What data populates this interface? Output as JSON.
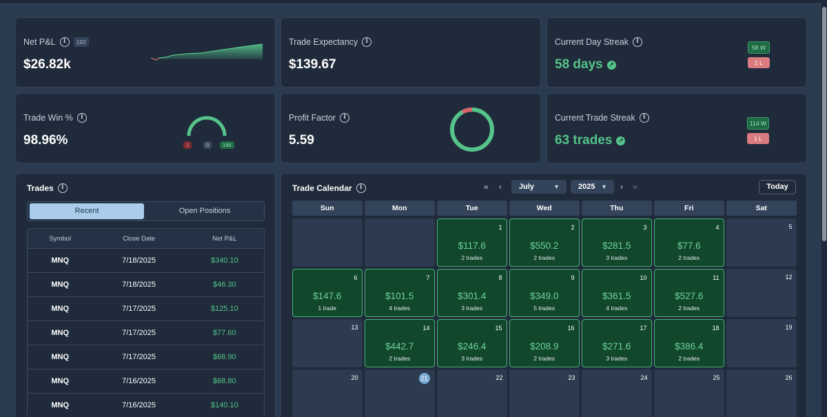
{
  "stats": {
    "net_pnl": {
      "title": "Net P&L",
      "badge": "192",
      "value": "$26.82k"
    },
    "trade_expectancy": {
      "title": "Trade Expectancy",
      "value": "$139.67"
    },
    "day_streak": {
      "title": "Current Day Streak",
      "value": "58 days",
      "wins": "58 W",
      "losses": "1 L"
    },
    "win_pct": {
      "title": "Trade Win %",
      "value": "98.96%",
      "losses": "2",
      "breakeven": "0",
      "wins": "190",
      "win_fraction": 0.9896
    },
    "profit_factor": {
      "title": "Profit Factor",
      "value": "5.59",
      "loss_fraction": 0.08
    },
    "trade_streak": {
      "title": "Current Trade Streak",
      "value": "63 trades",
      "wins": "114 W",
      "losses": "1 L"
    }
  },
  "colors": {
    "accent_green": "#56c48a",
    "loss_red": "#d97b7f",
    "panel": "#1f2a3a"
  },
  "trades": {
    "title": "Trades",
    "tabs": {
      "recent": "Recent",
      "open": "Open Positions"
    },
    "columns": [
      "Symbol",
      "Close Date",
      "Net P&L"
    ],
    "rows": [
      [
        "MNQ",
        "7/18/2025",
        "$340.10"
      ],
      [
        "MNQ",
        "7/18/2025",
        "$46.30"
      ],
      [
        "MNQ",
        "7/17/2025",
        "$125.10"
      ],
      [
        "MNQ",
        "7/17/2025",
        "$77.60"
      ],
      [
        "MNQ",
        "7/17/2025",
        "$68.90"
      ],
      [
        "MNQ",
        "7/16/2025",
        "$68.80"
      ],
      [
        "MNQ",
        "7/16/2025",
        "$140.10"
      ]
    ]
  },
  "calendar": {
    "title": "Trade Calendar",
    "month": "July",
    "year": "2025",
    "today_label": "Today",
    "weekdays": [
      "Sun",
      "Mon",
      "Tue",
      "Wed",
      "Thu",
      "Fri",
      "Sat"
    ],
    "first_weekday": 2,
    "today": 21,
    "days_shown": 26,
    "trades": {
      "1": [
        "$117.6",
        "2 trades"
      ],
      "2": [
        "$550.2",
        "2 trades"
      ],
      "3": [
        "$281.5",
        "3 trades"
      ],
      "4": [
        "$77.6",
        "2 trades"
      ],
      "6": [
        "$147.6",
        "1 trade"
      ],
      "7": [
        "$101.5",
        "4 trades"
      ],
      "8": [
        "$301.4",
        "3 trades"
      ],
      "9": [
        "$349.0",
        "5 trades"
      ],
      "10": [
        "$361.5",
        "4 trades"
      ],
      "11": [
        "$527.6",
        "2 trades"
      ],
      "14": [
        "$442.7",
        "2 trades"
      ],
      "15": [
        "$246.4",
        "3 trades"
      ],
      "16": [
        "$208.9",
        "2 trades"
      ],
      "17": [
        "$271.6",
        "3 trades"
      ],
      "18": [
        "$386.4",
        "2 trades"
      ]
    }
  }
}
